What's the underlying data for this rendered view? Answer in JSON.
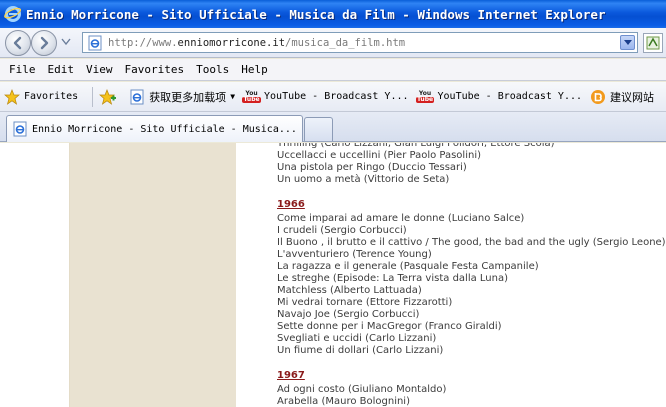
{
  "window": {
    "title": "Ennio Morricone - Sito Ufficiale - Musica da Film - Windows Internet Explorer"
  },
  "address_bar": {
    "url_scheme": "http://www.",
    "url_host": "enniomorricone.it",
    "url_path": "/musica_da_film.htm"
  },
  "menu": {
    "items": [
      "File",
      "Edit",
      "View",
      "Favorites",
      "Tools",
      "Help"
    ]
  },
  "favorites_bar": {
    "favorites_label": "Favorites",
    "items": [
      {
        "label": "获取更多加载项",
        "icon": "ie-page-icon",
        "has_dropdown": true
      },
      {
        "label": "YouTube - Broadcast Y...",
        "icon": "youtube-icon"
      },
      {
        "label": "YouTube - Broadcast Y...",
        "icon": "youtube-icon"
      },
      {
        "label": "建议网站",
        "icon": "suggested-sites-icon"
      }
    ],
    "youtube_icon_you": "You",
    "youtube_icon_tube": "Tube"
  },
  "tabs": {
    "active_label": "Ennio Morricone - Sito Ufficiale - Musica..."
  },
  "content": {
    "sections": [
      {
        "year": "",
        "films": [
          "Thrilling (Carlo Lizzani, Gian Luigi Polidori, Ettore Scola)",
          "Uccellacci e uccellini (Pier Paolo Pasolini)",
          "Una pistola per Ringo (Duccio Tessari)",
          "Un uomo a metà (Vittorio de Seta)"
        ]
      },
      {
        "year": "1966",
        "films": [
          "Come imparai ad amare le donne (Luciano Salce)",
          "I crudeli (Sergio Corbucci)",
          "Il Buono , il brutto e il cattivo / The good, the bad and the ugly (Sergio Leone)",
          "L'avventuriero (Terence Young)",
          "La ragazza e il generale (Pasquale Festa Campanile)",
          "Le streghe (Episode: La Terra vista dalla Luna)",
          "Matchless (Alberto Lattuada)",
          "Mi vedrai tornare (Ettore Fizzarotti)",
          "Navajo Joe (Sergio Corbucci)",
          "Sette donne per i MacGregor (Franco Giraldi)",
          "Svegliati e uccidi (Carlo Lizzani)",
          "Un fiume di dollari (Carlo Lizzani)"
        ]
      },
      {
        "year": "1967",
        "films": [
          "Ad ogni costo (Giuliano Montaldo)",
          "Arabella (Mauro Bolognini)"
        ]
      }
    ]
  },
  "colors": {
    "titlebar_blue": "#0a58dc",
    "year_link": "#8a1a1a",
    "sidebar_tan": "#e9e2d1",
    "body_text": "#3c3c3c"
  }
}
